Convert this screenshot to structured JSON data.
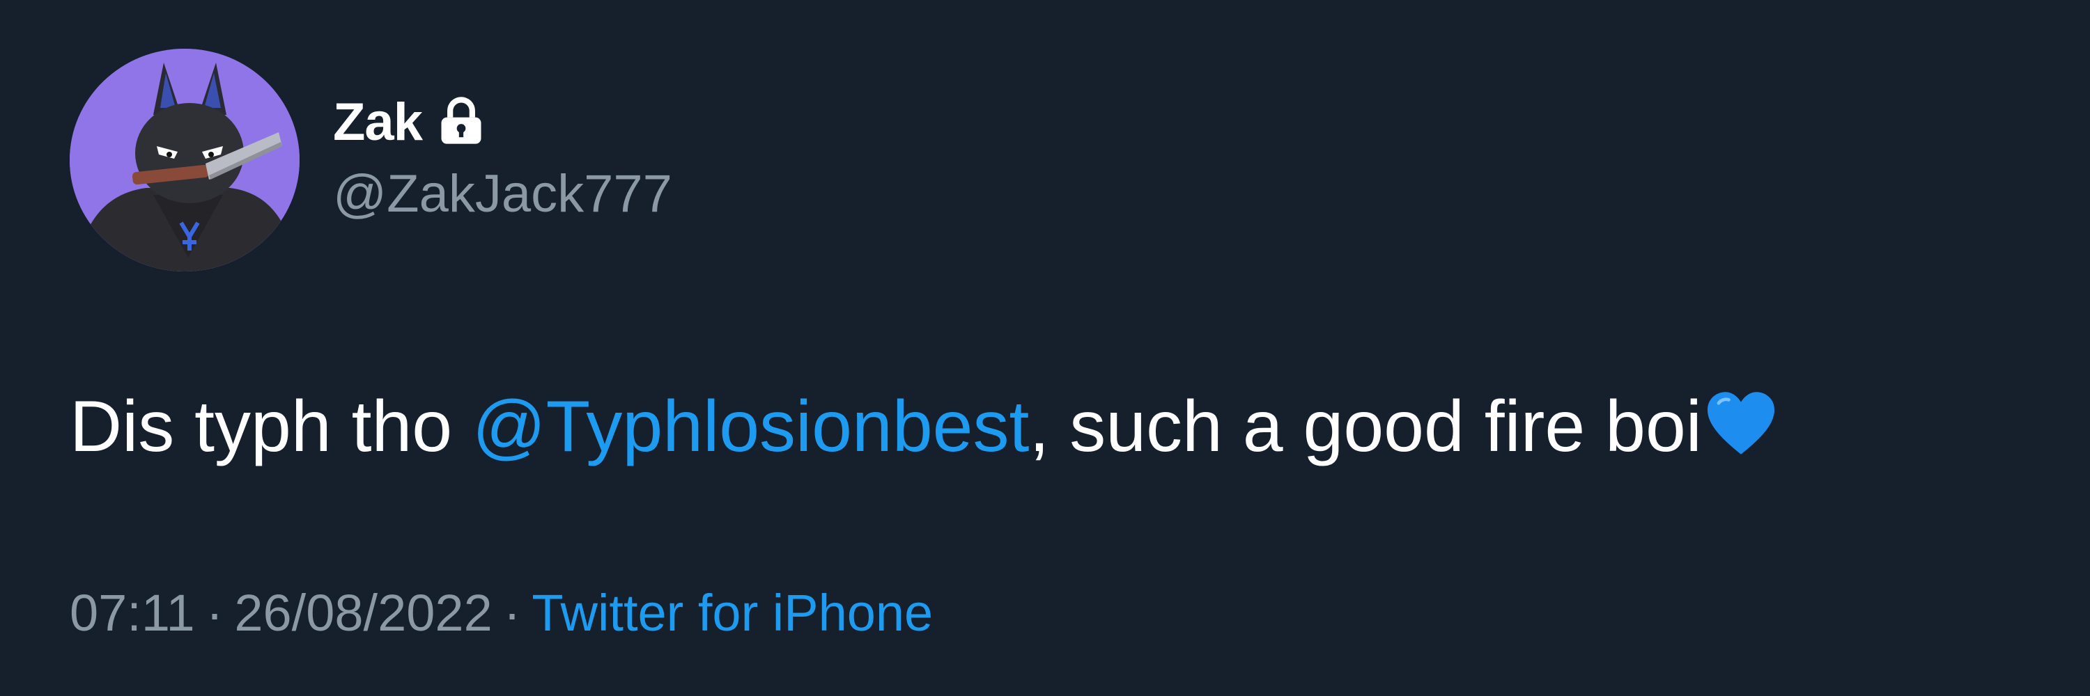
{
  "user": {
    "display_name": "Zak",
    "handle": "@ZakJack777",
    "protected_icon": "lock-icon",
    "avatar": "avatar"
  },
  "tweet": {
    "text_before": "Dis typh tho ",
    "mention": "@Typhlosionbest",
    "text_after": ", such a good fire boi",
    "emoji": "blue-heart-icon"
  },
  "meta": {
    "time": "07:11",
    "separator": "·",
    "date": "26/08/2022",
    "source": "Twitter for iPhone"
  },
  "colors": {
    "background": "#161f2c",
    "text": "#ffffff",
    "secondary": "#8b98a5",
    "link": "#1d9bf0",
    "avatar_bg": "#8f75e8",
    "heart": "#1d8df0"
  }
}
